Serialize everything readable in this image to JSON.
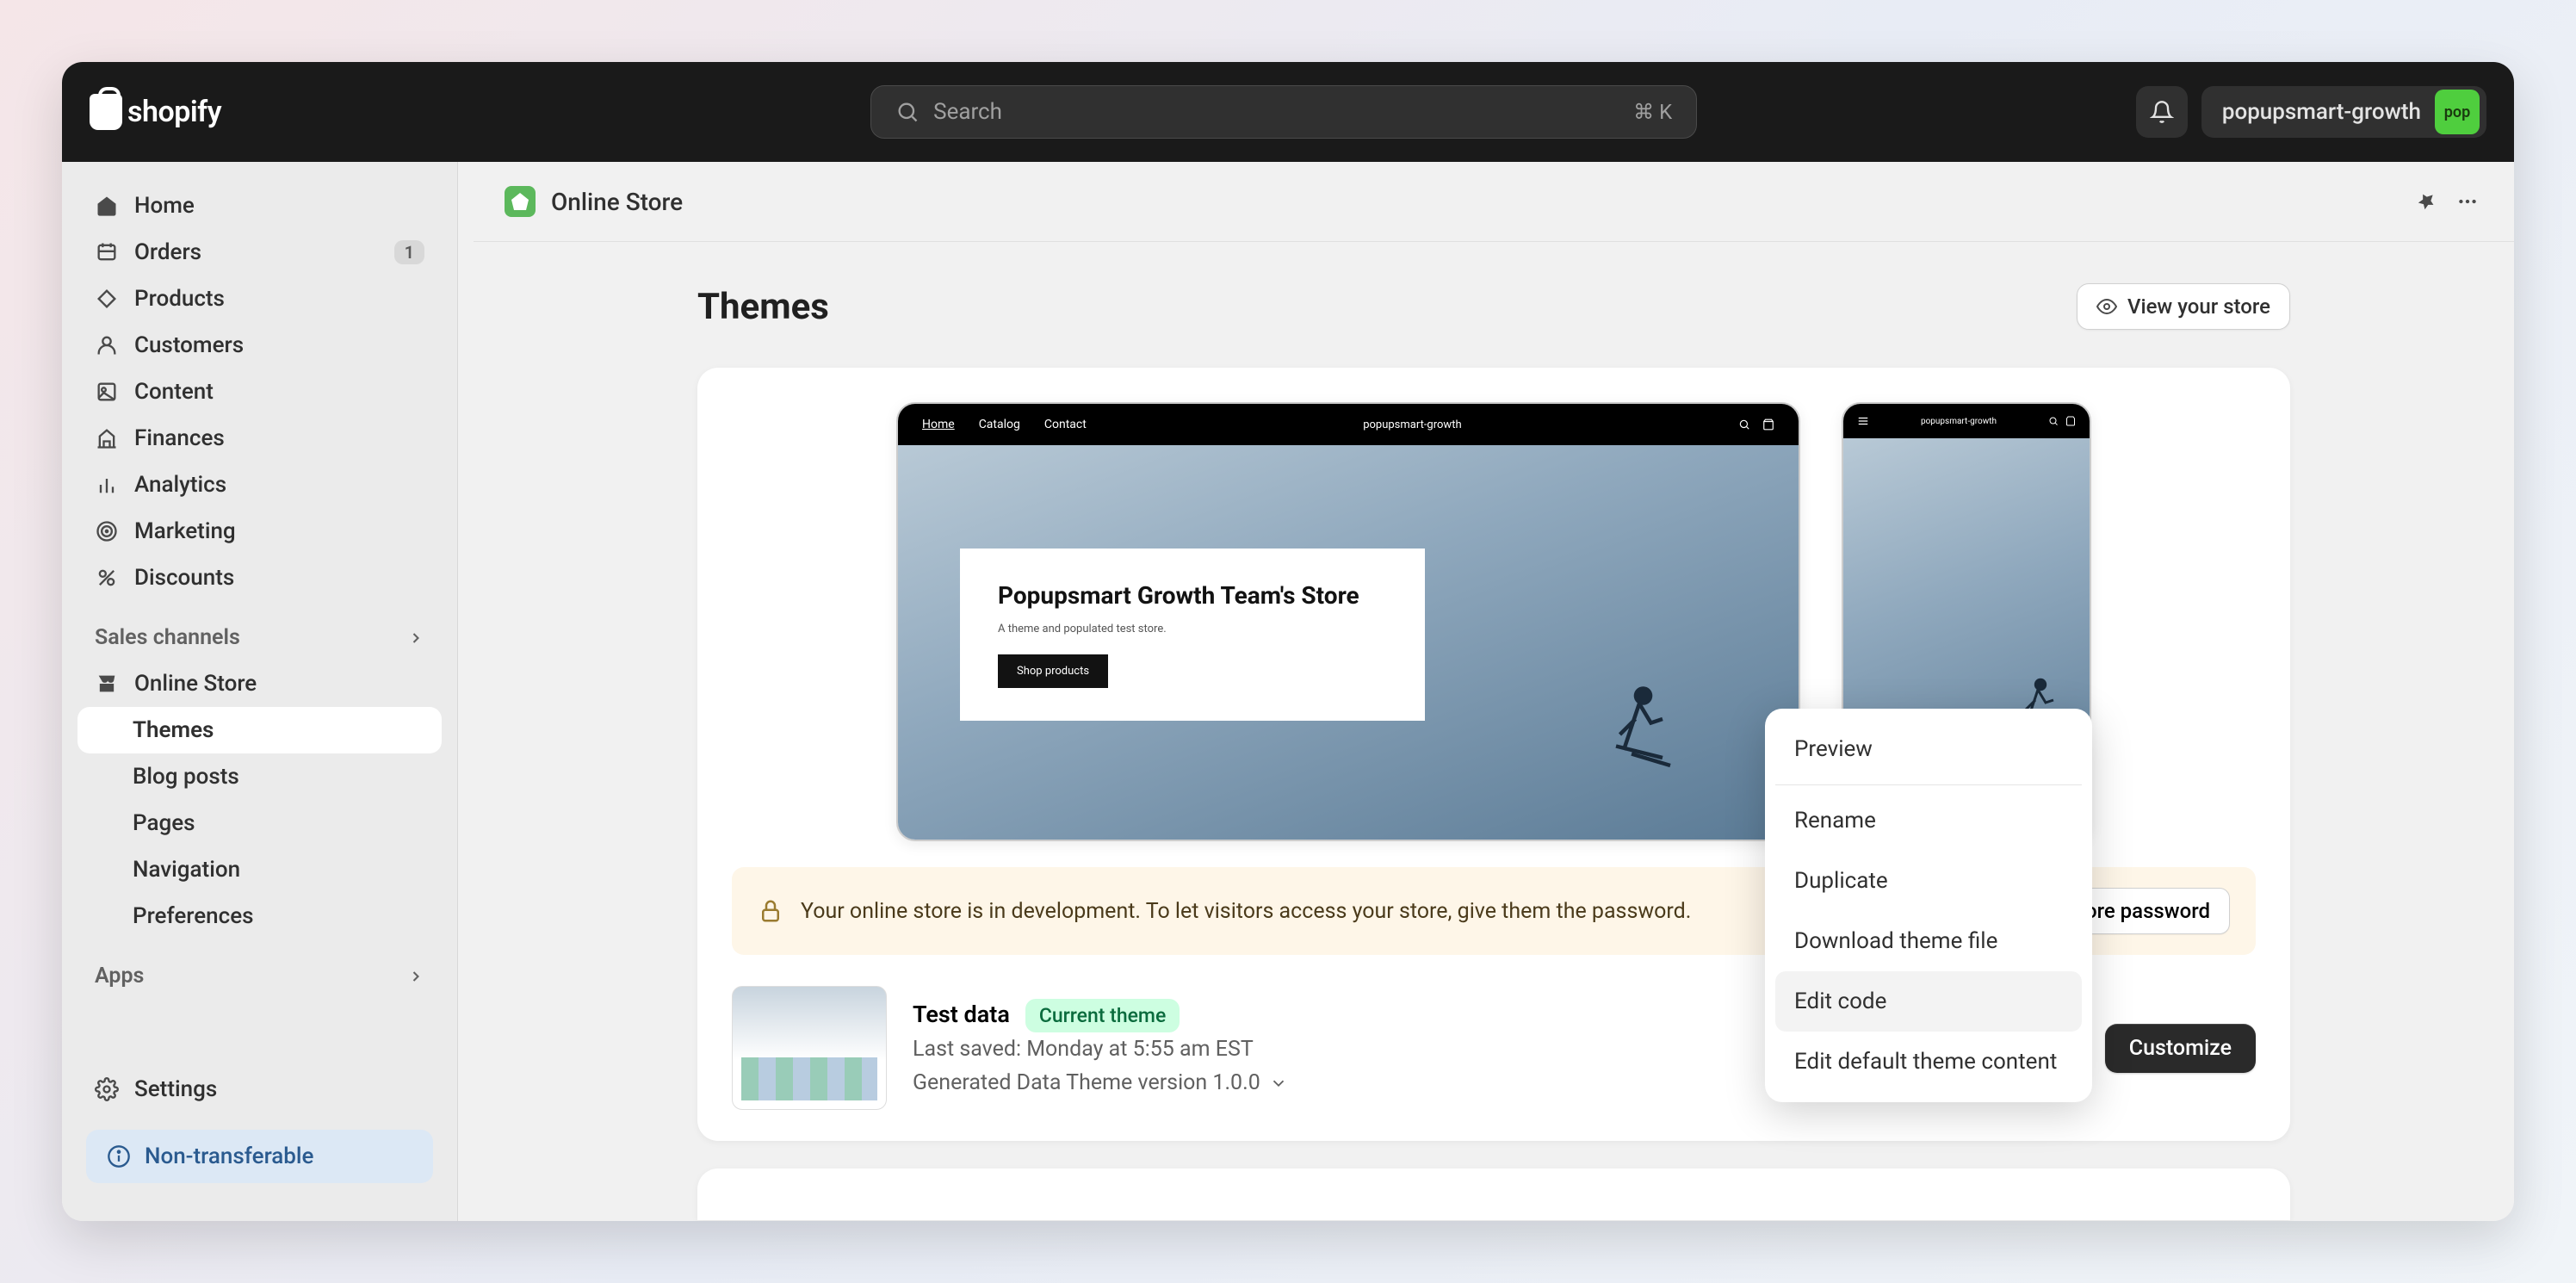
{
  "header": {
    "logo_text": "shopify",
    "search_placeholder": "Search",
    "search_shortcut": "⌘ K",
    "store_name": "popupsmart-growth",
    "avatar_label": "pop"
  },
  "sidebar": {
    "items": [
      {
        "label": "Home"
      },
      {
        "label": "Orders",
        "badge": "1"
      },
      {
        "label": "Products"
      },
      {
        "label": "Customers"
      },
      {
        "label": "Content"
      },
      {
        "label": "Finances"
      },
      {
        "label": "Analytics"
      },
      {
        "label": "Marketing"
      },
      {
        "label": "Discounts"
      }
    ],
    "sales_channels_header": "Sales channels",
    "online_store": {
      "label": "Online Store",
      "sub": [
        {
          "label": "Themes",
          "active": true
        },
        {
          "label": "Blog posts"
        },
        {
          "label": "Pages"
        },
        {
          "label": "Navigation"
        },
        {
          "label": "Preferences"
        }
      ]
    },
    "apps_header": "Apps",
    "settings_label": "Settings",
    "info_pill": "Non-transferable"
  },
  "page": {
    "breadcrumb_title": "Online Store",
    "heading": "Themes",
    "view_store_label": "View your store",
    "preview_desktop": {
      "nav": {
        "home": "Home",
        "catalog": "Catalog",
        "contact": "Contact"
      },
      "brand": "popupsmart-growth",
      "hero_title": "Popupsmart Growth Team's Store",
      "hero_subtitle": "A theme and populated test store.",
      "hero_cta": "Shop products"
    },
    "preview_mobile": {
      "brand": "popupsmart-growth"
    },
    "dev_banner": {
      "text": "Your online store is in development. To let visitors access your store, give them the password.",
      "button": "Remove store password"
    },
    "theme": {
      "name": "Test data",
      "badge": "Current theme",
      "last_saved": "Last saved: Monday at 5:55 am EST",
      "version": "Generated Data Theme version 1.0.0",
      "customize": "Customize"
    },
    "popover": [
      "Preview",
      "Rename",
      "Duplicate",
      "Download theme file",
      "Edit code",
      "Edit default theme content"
    ]
  }
}
